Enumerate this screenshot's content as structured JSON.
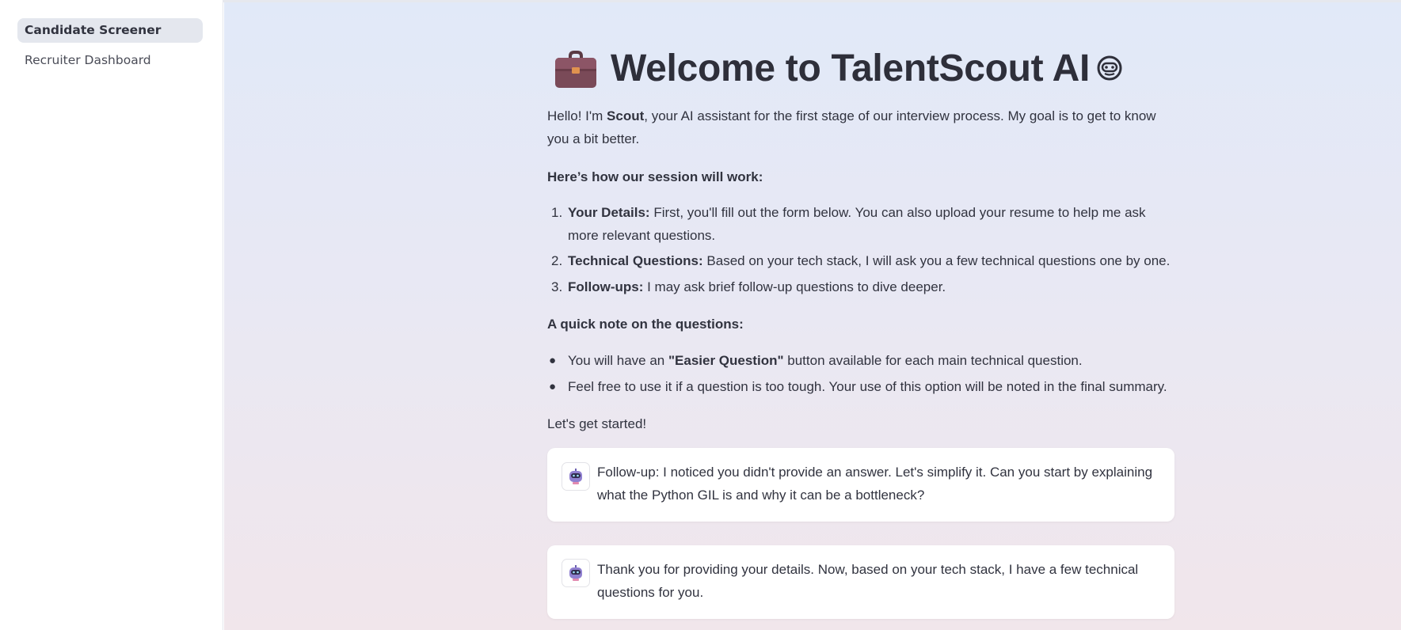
{
  "sidebar": {
    "items": [
      {
        "label": "Candidate Screener",
        "active": true
      },
      {
        "label": "Recruiter Dashboard",
        "active": false
      }
    ]
  },
  "header": {
    "title": "Welcome to TalentScout AI",
    "title_icon": "briefcase-icon",
    "title_trailing_icon": "robot-icon"
  },
  "intro": {
    "t1": "Hello! I'm ",
    "name": "Scout",
    "t2": ", your AI assistant for the first stage of our interview process. My goal is to get to know you a bit better."
  },
  "session": {
    "heading": "Here’s how our session will work:",
    "steps": [
      {
        "num": "1.",
        "bold": "Your Details:",
        "text": " First, you'll fill out the form below. You can also upload your resume to help me ask more relevant questions."
      },
      {
        "num": "2.",
        "bold": "Technical Questions:",
        "text": " Based on your tech stack, I will ask you a few technical questions one by one."
      },
      {
        "num": "3.",
        "bold": "Follow-ups:",
        "text": " I may ask brief follow-up questions to dive deeper."
      }
    ]
  },
  "note": {
    "heading": "A quick note on the questions:",
    "bullets": [
      {
        "pre": "You will have an ",
        "bold": "\"Easier Question\"",
        "post": " button available for each main technical question."
      },
      {
        "text": "Feel free to use it if a question is too tough. Your use of this option will be noted in the final summary."
      }
    ]
  },
  "start_text": "Let's get started!",
  "messages": [
    {
      "avatar": "robot-avatar-icon",
      "text": "Follow-up: I noticed you didn't provide an answer. Let's simplify it. Can you start by explaining what the Python GIL is and why it can be a bottleneck?"
    },
    {
      "avatar": "robot-avatar-icon",
      "text": "Thank you for providing your details. Now, based on your tech stack, I have a few technical questions for you."
    }
  ],
  "colors": {
    "sidebar_bg": "#ffffff",
    "active_item_bg": "#e4e7ee",
    "main_gradient_top": "#e1e9f8",
    "main_gradient_bottom": "#f1e6eb",
    "text": "#31333f",
    "card_bg": "#ffffff"
  }
}
